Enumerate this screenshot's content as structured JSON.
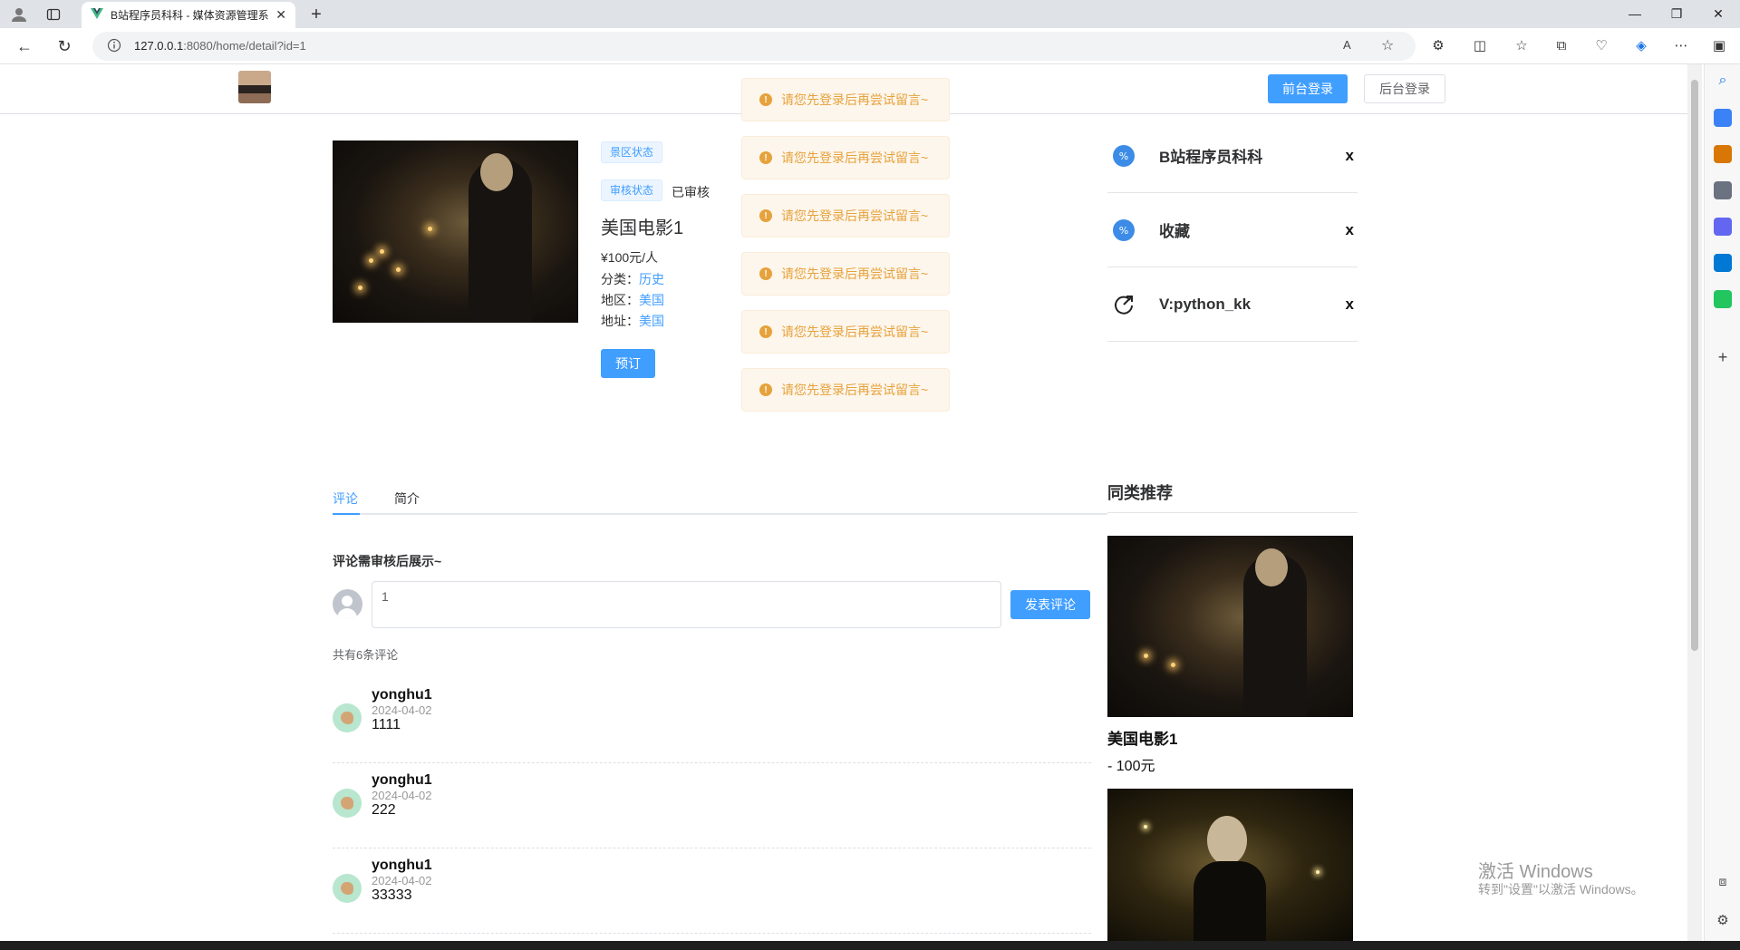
{
  "browser": {
    "tab_title": "B站程序员科科 - 媒体资源管理系",
    "url_host": "127.0.0.1",
    "url_rest": ":8080/home/detail?id=1"
  },
  "header": {
    "front_login": "前台登录",
    "back_login": "后台登录"
  },
  "product": {
    "tag_scenic": "景区状态",
    "tag_audit": "审核状态",
    "audit_value": "已审核",
    "title": "美国电影1",
    "price": "¥100元/人",
    "category_label": "分类：",
    "category_value": "历史",
    "region_label": "地区：",
    "region_value": "美国",
    "address_label": "地址：",
    "address_value": "美国",
    "book_button": "预订"
  },
  "toasts": [
    "请您先登录后再尝试留言~",
    "请您先登录后再尝试留言~",
    "请您先登录后再尝试留言~",
    "请您先登录后再尝试留言~",
    "请您先登录后再尝试留言~",
    "请您先登录后再尝试留言~"
  ],
  "side_list": [
    {
      "label": "B站程序员科科",
      "close": "x"
    },
    {
      "label": "收藏",
      "close": "x"
    },
    {
      "label": "V:python_kk",
      "close": "x"
    }
  ],
  "tabs": {
    "comment": "评论",
    "intro": "简介"
  },
  "comments_section": {
    "hint": "评论需审核后展示~",
    "input_value": "1",
    "post_button": "发表评论",
    "count": "共有6条评论",
    "items": [
      {
        "user": "yonghu1",
        "date": "2024-04-02",
        "text": "1111"
      },
      {
        "user": "yonghu1",
        "date": "2024-04-02",
        "text": "222"
      },
      {
        "user": "yonghu1",
        "date": "2024-04-02",
        "text": "33333"
      }
    ]
  },
  "recommend": {
    "title": "同类推荐",
    "items": [
      {
        "name": "美国电影1",
        "price": "- 100元"
      }
    ]
  },
  "watermark": {
    "line1": "激活 Windows",
    "line2": "转到\"设置\"以激活 Windows。"
  },
  "colors": {
    "primary": "#409eff",
    "warning": "#e6a23c"
  }
}
